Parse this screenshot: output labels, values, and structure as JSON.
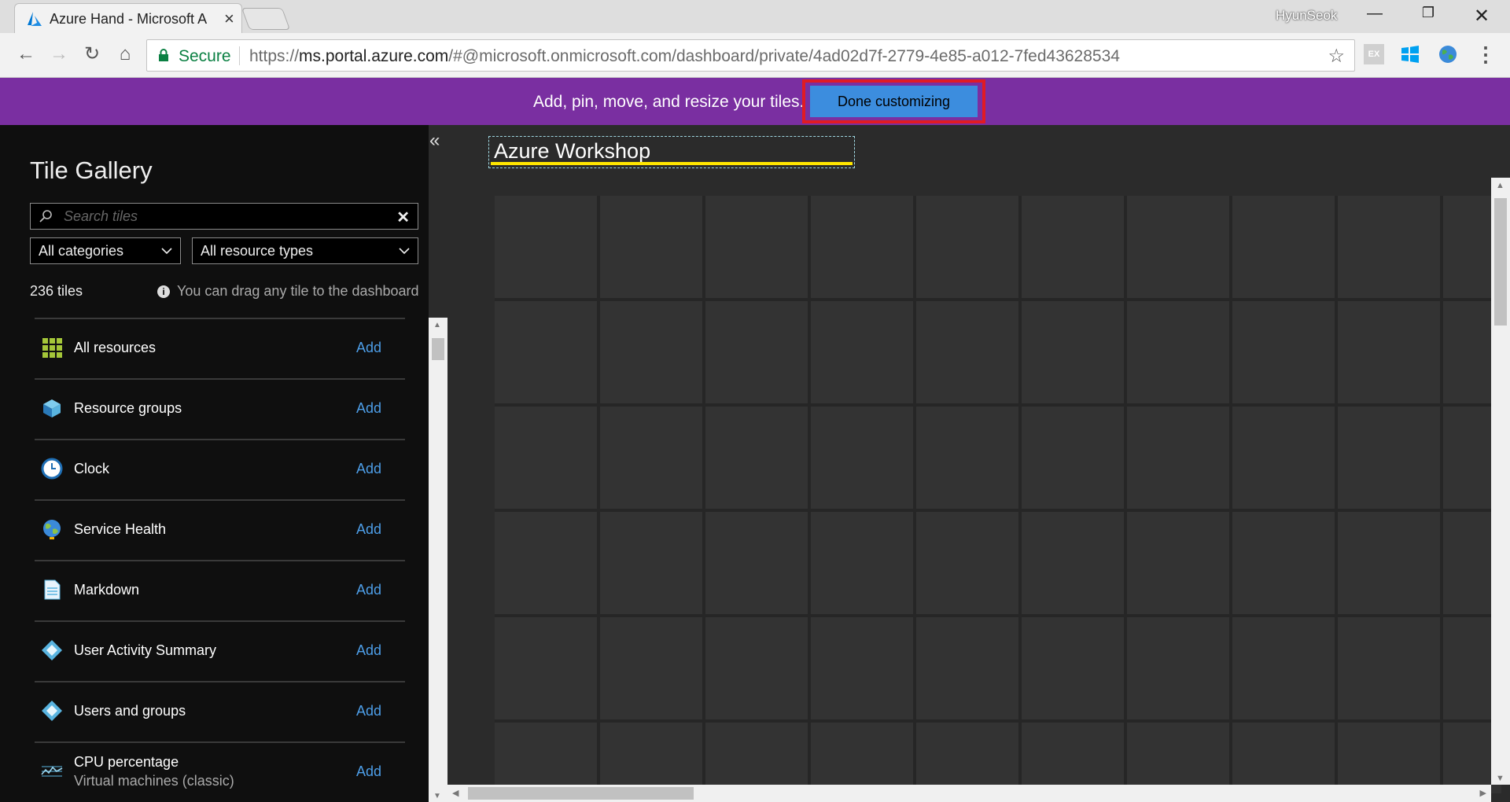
{
  "browser": {
    "tab_title": "Azure Hand - Microsoft A",
    "user_name": "HyunSeok",
    "secure_label": "Secure",
    "url_scheme": "https://",
    "url_host": "ms.portal.azure.com",
    "url_path": "/#@microsoft.onmicrosoft.com/dashboard/private/4ad02d7f-2779-4e85-a012-7fed43628534",
    "ext_label": "EX"
  },
  "customize_bar": {
    "message": "Add, pin, move, and resize your tiles.",
    "done_label": "Done customizing"
  },
  "gallery": {
    "title": "Tile Gallery",
    "search_placeholder": "Search tiles",
    "category_select": "All categories",
    "resource_type_select": "All resource types",
    "tiles_count": "236 tiles",
    "drag_hint": "You can drag any tile to the dashboard",
    "add_label": "Add",
    "items": [
      {
        "label": "All resources",
        "icon": "grid-icon"
      },
      {
        "label": "Resource groups",
        "icon": "cube-icon"
      },
      {
        "label": "Clock",
        "icon": "clock-icon"
      },
      {
        "label": "Service Health",
        "icon": "globe-icon"
      },
      {
        "label": "Markdown",
        "icon": "document-icon"
      },
      {
        "label": "User Activity Summary",
        "icon": "diamond-icon"
      },
      {
        "label": "Users and groups",
        "icon": "diamond-icon"
      },
      {
        "label": "CPU percentage",
        "sublabel": "Virtual machines (classic)",
        "icon": "chart-icon"
      }
    ]
  },
  "dashboard": {
    "title": "Azure Workshop"
  },
  "colors": {
    "accent_purple": "#7a2fa1",
    "button_blue": "#3c8dde",
    "highlight_red": "#e01b24",
    "link_blue": "#4d9ee8",
    "title_underline": "#ffe600"
  }
}
